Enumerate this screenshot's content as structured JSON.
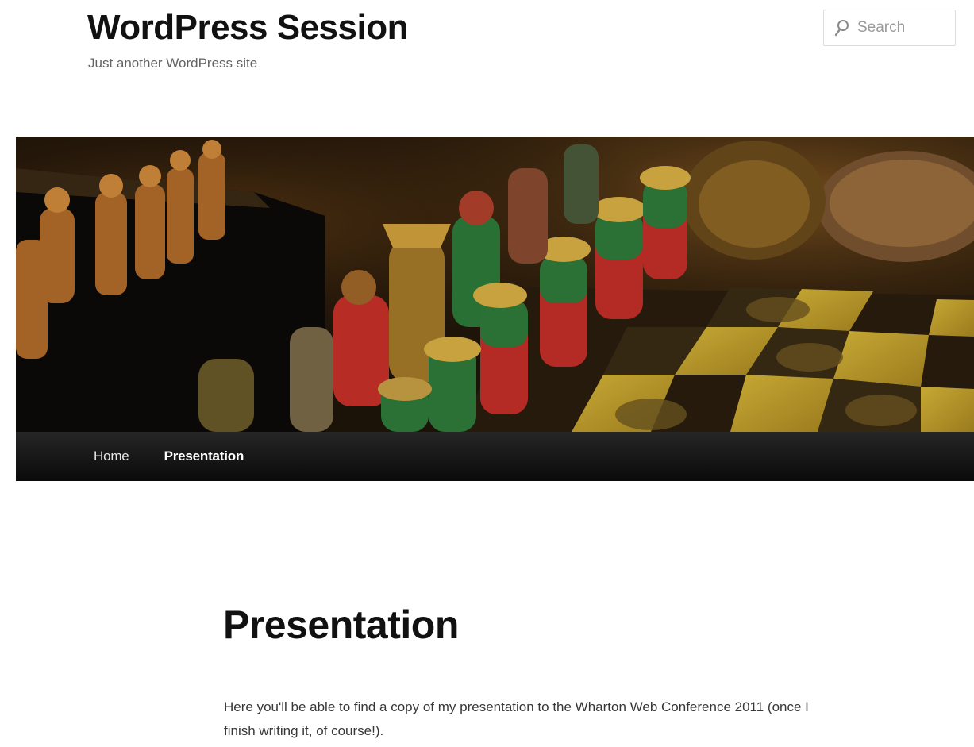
{
  "header": {
    "site_title": "WordPress Session",
    "site_description": "Just another WordPress site",
    "search": {
      "placeholder": "Search",
      "icon": "search-icon"
    }
  },
  "banner": {
    "subject": "chess set photograph",
    "colors": {
      "board_yellow": "#c8a62a",
      "piece_red": "#c72a2a",
      "piece_green": "#2f7a3a",
      "piece_wood": "#b2702c"
    }
  },
  "nav": {
    "items": [
      {
        "label": "Home",
        "current": false
      },
      {
        "label": "Presentation",
        "current": true
      }
    ]
  },
  "content": {
    "title": "Presentation",
    "body": "Here you'll be able to find a copy of my presentation to the Wharton Web Conference 2011 (once I finish writing it, of course!)."
  }
}
